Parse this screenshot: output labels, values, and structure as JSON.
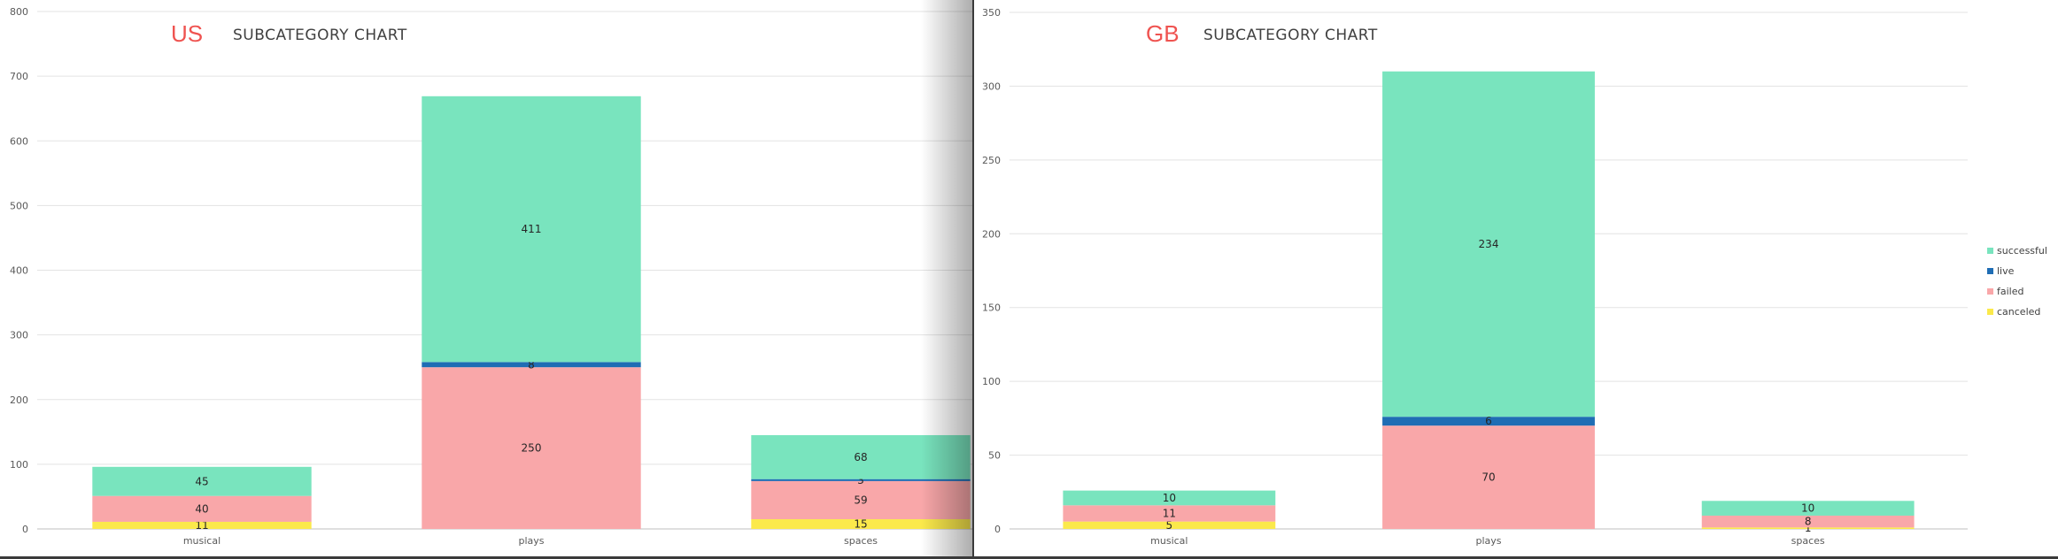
{
  "chart_data": [
    {
      "type": "bar",
      "stacked": true,
      "country": "US",
      "title": "SUBCATEGORY CHART",
      "categories": [
        "musical",
        "plays",
        "spaces"
      ],
      "series": [
        {
          "name": "canceled",
          "values": [
            11,
            0,
            15
          ],
          "labels": [
            "11",
            "",
            "15"
          ]
        },
        {
          "name": "failed",
          "values": [
            40,
            250,
            59
          ],
          "labels": [
            "40",
            "250",
            "59"
          ]
        },
        {
          "name": "live",
          "values": [
            0,
            8,
            3
          ],
          "labels": [
            "",
            "8",
            "3"
          ]
        },
        {
          "name": "successful",
          "values": [
            45,
            411,
            68
          ],
          "labels": [
            "45",
            "411",
            "68"
          ]
        }
      ],
      "ylim": [
        0,
        800
      ],
      "yticks": [
        0,
        100,
        200,
        300,
        400,
        500,
        600,
        700,
        800
      ],
      "grid": true,
      "legend": "none"
    },
    {
      "type": "bar",
      "stacked": true,
      "country": "GB",
      "title": "SUBCATEGORY CHART",
      "categories": [
        "musical",
        "plays",
        "spaces"
      ],
      "series": [
        {
          "name": "canceled",
          "values": [
            5,
            0,
            1
          ],
          "labels": [
            "5",
            "",
            "1"
          ]
        },
        {
          "name": "failed",
          "values": [
            11,
            70,
            8
          ],
          "labels": [
            "11",
            "70",
            "8"
          ]
        },
        {
          "name": "live",
          "values": [
            0,
            6,
            0
          ],
          "labels": [
            "",
            "6",
            ""
          ]
        },
        {
          "name": "successful",
          "values": [
            10,
            234,
            10
          ],
          "labels": [
            "10",
            "234",
            "10"
          ]
        }
      ],
      "ylim": [
        0,
        350
      ],
      "yticks": [
        0,
        50,
        100,
        150,
        200,
        250,
        300,
        350
      ],
      "grid": true,
      "legend": "right"
    }
  ],
  "legend": {
    "items": [
      {
        "name": "successful",
        "color": "#79e4be"
      },
      {
        "name": "live",
        "color": "#1f6db4"
      },
      {
        "name": "failed",
        "color": "#f9a7a9"
      },
      {
        "name": "canceled",
        "color": "#fbe94b"
      }
    ]
  },
  "colors": {
    "canceled": "#fbe94b",
    "failed": "#f9a7a9",
    "live": "#1f6db4",
    "successful": "#79e4be",
    "country": "#ef5350",
    "grid": "#e3e3e3"
  }
}
